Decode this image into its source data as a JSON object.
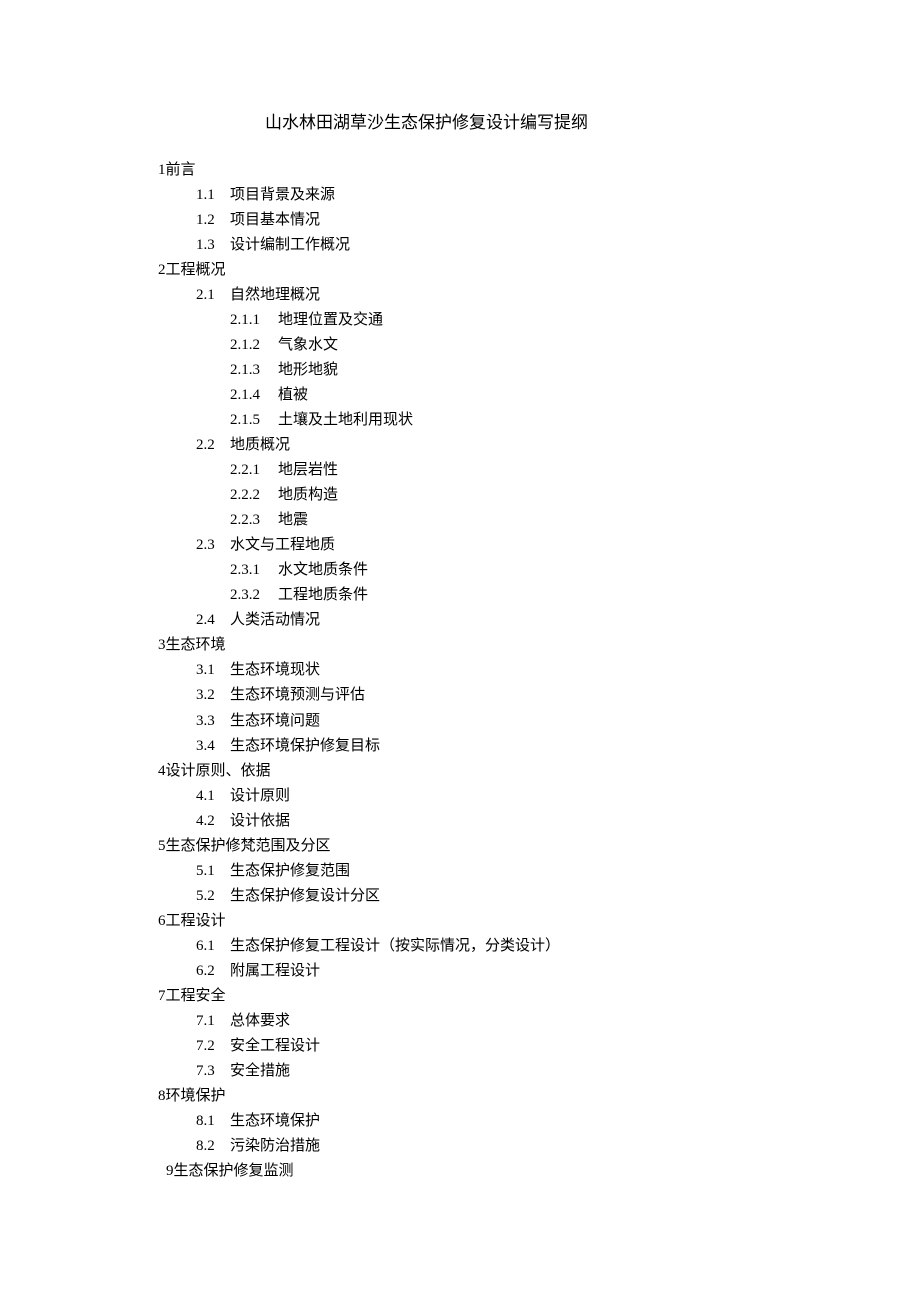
{
  "title": "山水林田湖草沙生态保护修复设计编写提纲",
  "outline": {
    "s1": {
      "num": "1",
      "title": "前言",
      "i1": {
        "num": "1.1",
        "text": "项目背景及来源"
      },
      "i2": {
        "num": "1.2",
        "text": "项目基本情况"
      },
      "i3": {
        "num": "1.3",
        "text": "设计编制工作概况"
      }
    },
    "s2": {
      "num": "2",
      "title": "工程概况",
      "i1": {
        "num": "2.1",
        "text": "自然地理概况",
        "j1": {
          "num": "2.1.1",
          "text": "地理位置及交通"
        },
        "j2": {
          "num": "2.1.2",
          "text": "气象水文"
        },
        "j3": {
          "num": "2.1.3",
          "text": "地形地貌"
        },
        "j4": {
          "num": "2.1.4",
          "text": "植被"
        },
        "j5": {
          "num": "2.1.5",
          "text": "土壤及土地利用现状"
        }
      },
      "i2": {
        "num": "2.2",
        "text": "地质概况",
        "j1": {
          "num": "2.2.1",
          "text": "地层岩性"
        },
        "j2": {
          "num": "2.2.2",
          "text": "地质构造"
        },
        "j3": {
          "num": "2.2.3",
          "text": "地震"
        }
      },
      "i3": {
        "num": "2.3",
        "text": "水文与工程地质",
        "j1": {
          "num": "2.3.1",
          "text": "水文地质条件"
        },
        "j2": {
          "num": "2.3.2",
          "text": "工程地质条件"
        }
      },
      "i4": {
        "num": "2.4",
        "text": "人类活动情况"
      }
    },
    "s3": {
      "num": "3",
      "title": "生态环境",
      "i1": {
        "num": "3.1",
        "text": "生态环境现状"
      },
      "i2": {
        "num": "3.2",
        "text": "生态环境预测与评估"
      },
      "i3": {
        "num": "3.3",
        "text": "生态环境问题"
      },
      "i4": {
        "num": "3.4",
        "text": "生态环境保护修复目标"
      }
    },
    "s4": {
      "num": "4",
      "title": "设计原则、依据",
      "i1": {
        "num": "4.1",
        "text": "设计原则"
      },
      "i2": {
        "num": "4.2",
        "text": "设计依据"
      }
    },
    "s5": {
      "num": "5",
      "title": "生态保护修梵范围及分区",
      "i1": {
        "num": "5.1",
        "text": "生态保护修复范围"
      },
      "i2": {
        "num": "5.2",
        "text": "生态保护修复设计分区"
      }
    },
    "s6": {
      "num": "6",
      "title": "工程设计",
      "i1": {
        "num": "6.1",
        "text": "生态保护修复工程设计（按实际情况，分类设计）"
      },
      "i2": {
        "num": "6.2",
        "text": "附属工程设计"
      }
    },
    "s7": {
      "num": "7",
      "title": "工程安全",
      "i1": {
        "num": "7.1",
        "text": "总体要求"
      },
      "i2": {
        "num": "7.2",
        "text": "安全工程设计"
      },
      "i3": {
        "num": "7.3",
        "text": "安全措施"
      }
    },
    "s8": {
      "num": "8",
      "title": "环境保护",
      "i1": {
        "num": "8.1",
        "text": "生态环境保护"
      },
      "i2": {
        "num": "8.2",
        "text": "污染防治措施"
      }
    },
    "s9": {
      "num": "9",
      "title": "生态保护修复监测"
    }
  }
}
